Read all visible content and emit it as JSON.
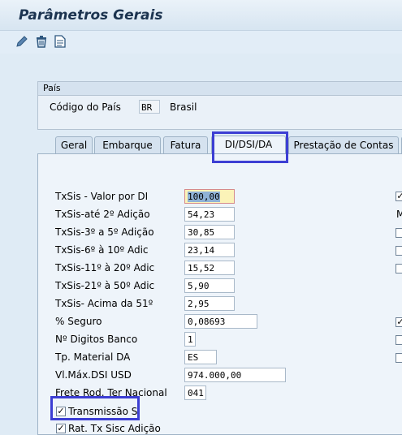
{
  "window": {
    "title": "Parâmetros Gerais"
  },
  "toolbar": {
    "icons": [
      "pencil-icon",
      "trash-icon",
      "document-icon"
    ]
  },
  "pais_group": {
    "title": "País",
    "codigo_label": "Código do País",
    "codigo_value": "BR",
    "country_name": "Brasil"
  },
  "tabs": [
    "Geral",
    "Embarque",
    "Fatura",
    "DI/DSI/DA",
    "Prestação de Contas"
  ],
  "active_tab": "DI/DSI/DA",
  "fields": [
    {
      "label": "TxSis - Valor por DI",
      "value": "100,00"
    },
    {
      "label": "TxSis-até 2º Adição",
      "value": "54,23"
    },
    {
      "label": "TxSis-3º a 5º Adição",
      "value": "30,85"
    },
    {
      "label": "TxSis-6º à 10º Adic",
      "value": "23,14"
    },
    {
      "label": "TxSis-11º à 20º Adic",
      "value": "15,52"
    },
    {
      "label": "TxSis-21º à 50º Adic",
      "value": "5,90"
    },
    {
      "label": "TxSis- Acima da 51º",
      "value": "2,95"
    },
    {
      "label": "% Seguro",
      "value": "0,08693"
    },
    {
      "label": "Nº Digitos Banco",
      "value": "1"
    },
    {
      "label": "Tp. Material DA",
      "value": "ES"
    },
    {
      "label": "Vl.Máx.DSI USD",
      "value": "974.000,00"
    },
    {
      "label": "Frete Rod. Ter Nacional",
      "value": "041"
    }
  ],
  "checkboxes": [
    {
      "label": "Transmissão Si",
      "checked": true
    },
    {
      "label": "Rat. Tx Sisc Adição",
      "checked": true
    }
  ],
  "right_column": {
    "partial_label": "M"
  },
  "colors": {
    "highlight": "#3c3ed3",
    "focus_field": "#fbf3b8"
  }
}
